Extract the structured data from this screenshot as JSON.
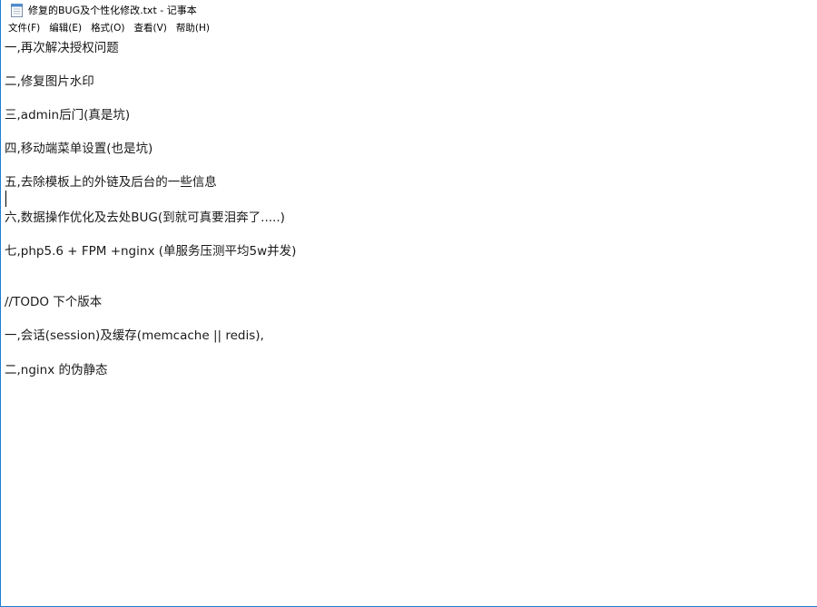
{
  "window": {
    "title": "修复的BUG及个性化修改.txt - 记事本",
    "icon": "notepad-icon",
    "border_color": "#1a7fd6"
  },
  "menu": {
    "file": "文件(F)",
    "edit": "编辑(E)",
    "format": "格式(O)",
    "view": "查看(V)",
    "help": "帮助(H)"
  },
  "document": {
    "lines": [
      "一,再次解决授权问题",
      "二,修复图片水印",
      "三,admin后门(真是坑)",
      "四,移动端菜单设置(也是坑)",
      "五,去除模板上的外链及后台的一些信息",
      "六,数据操作优化及去处BUG(到就可真要泪奔了.....)",
      "七,php5.6 + FPM +nginx  (单服务压测平均5w并发)",
      "//TODO  下个版本",
      "一,会话(session)及缓存(memcache || redis),",
      "二,nginx 的伪静态"
    ]
  }
}
